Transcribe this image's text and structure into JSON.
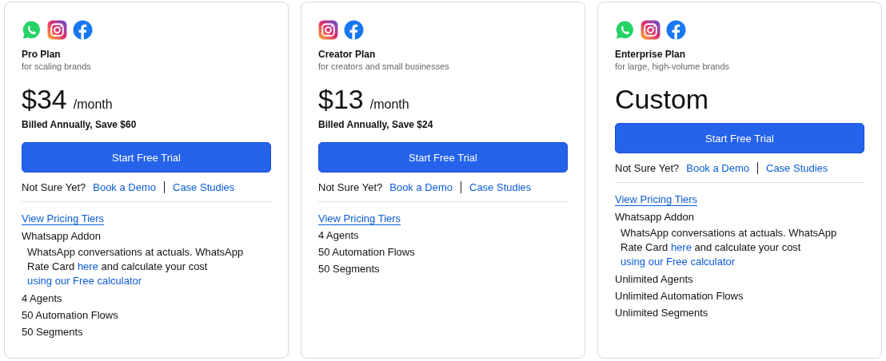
{
  "plans": [
    {
      "channels": [
        {
          "kind": "whatsapp"
        },
        {
          "kind": "instagram"
        },
        {
          "kind": "facebook"
        }
      ],
      "name": "Pro Plan",
      "tagline": "for scaling brands",
      "price": {
        "amount": "$34",
        "period": "/month"
      },
      "billing": "Billed Annually, Save $60",
      "cta": "Start Free Trial",
      "unsure": {
        "prompt": "Not Sure Yet?",
        "links": [
          "Book a Demo",
          "Case Studies"
        ]
      },
      "tiers_link": "View Pricing Tiers",
      "addon": {
        "title": "Whatsapp Addon",
        "parts": [
          {
            "kind": "text",
            "text": "WhatsApp conversations at actuals. WhatsApp Rate Card "
          },
          {
            "kind": "link",
            "text": "here"
          },
          {
            "kind": "text",
            "text": " and calculate your cost "
          },
          {
            "kind": "link",
            "text": "using our Free calculator"
          }
        ]
      },
      "features": [
        "4 Agents",
        "50 Automation Flows",
        "50 Segments"
      ]
    },
    {
      "channels": [
        {
          "kind": "instagram"
        },
        {
          "kind": "facebook"
        }
      ],
      "name": "Creator Plan",
      "tagline": "for creators and small businesses",
      "price": {
        "amount": "$13",
        "period": "/month"
      },
      "billing": "Billed Annually, Save $24",
      "cta": "Start Free Trial",
      "unsure": {
        "prompt": "Not Sure Yet?",
        "links": [
          "Book a Demo",
          "Case Studies"
        ]
      },
      "tiers_link": "View Pricing Tiers",
      "features": [
        "4 Agents",
        "50 Automation Flows",
        "50 Segments"
      ]
    },
    {
      "channels": [
        {
          "kind": "whatsapp"
        },
        {
          "kind": "instagram"
        },
        {
          "kind": "facebook"
        }
      ],
      "name": "Enterprise Plan",
      "tagline": "for large, high-volume brands",
      "price": {
        "amount": "Custom"
      },
      "cta": "Start Free Trial",
      "unsure": {
        "prompt": "Not Sure Yet?",
        "links": [
          "Book a Demo",
          "Case Studies"
        ]
      },
      "tiers_link": "View Pricing Tiers",
      "addon": {
        "title": "Whatsapp Addon",
        "parts": [
          {
            "kind": "text",
            "text": "WhatsApp conversations at actuals. WhatsApp Rate Card "
          },
          {
            "kind": "link",
            "text": "here"
          },
          {
            "kind": "text",
            "text": " and calculate your cost "
          },
          {
            "kind": "link",
            "text": "using our Free calculator"
          }
        ]
      },
      "features": [
        "Unlimited Agents",
        "Unlimited Automation Flows",
        "Unlimited Segments"
      ]
    }
  ]
}
